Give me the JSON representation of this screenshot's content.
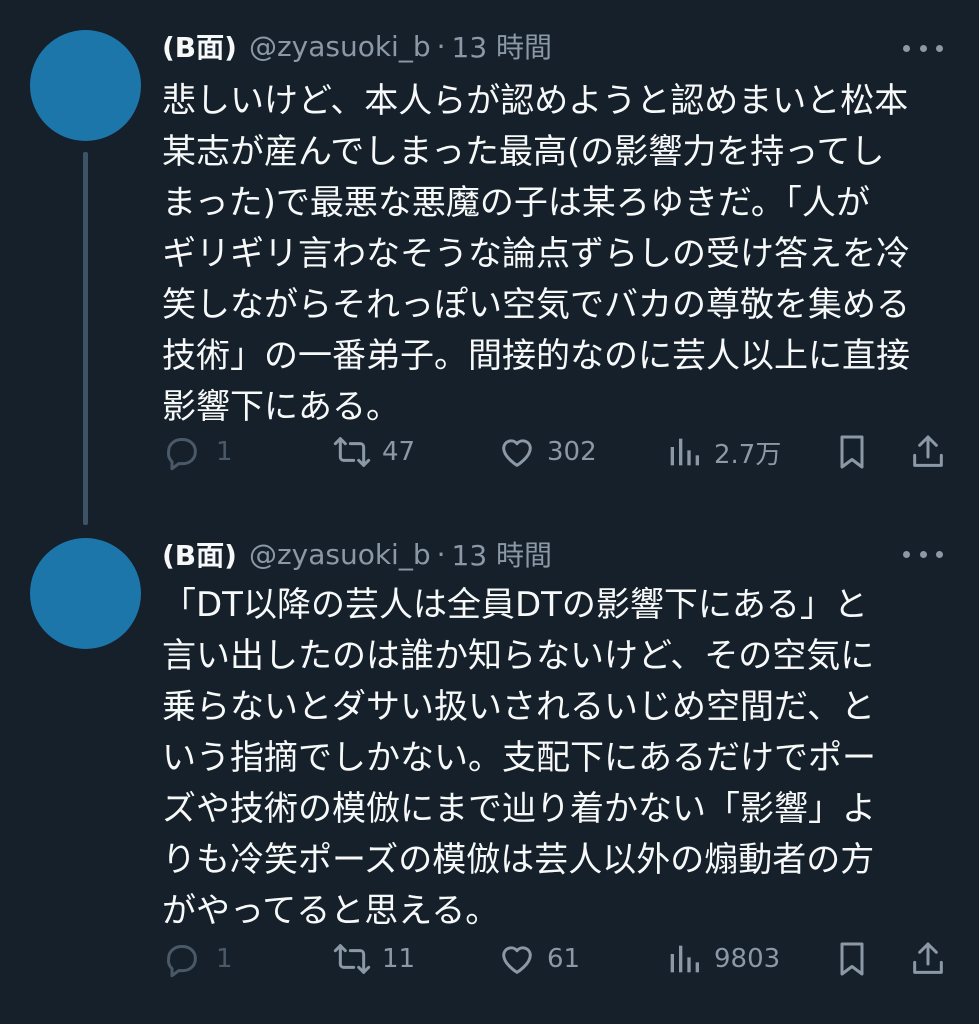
{
  "tweets": [
    {
      "display_name": "(B面)",
      "handle": "@zyasuoki_b",
      "separator": "·",
      "time": "13 時間",
      "avatar_color": "#1d76aa",
      "lines": [
        "悲しいけど、本人らが認めようと認めまいと松本",
        "某志が産んでしまった最高(の影響力を持ってし",
        "まった)で最悪な悪魔の子は某ろゆきだ。「人が",
        "ギリギリ言わなそうな論点ずらしの受け答えを冷",
        "笑しながらそれっぽい空気でバカの尊敬を集める",
        "技術」の一番弟子。間接的なのに芸人以上に直接",
        "影響下にある。"
      ],
      "actions": {
        "reply_icon": "reply-icon",
        "reply_count": "1",
        "retweet_icon": "retweet-icon",
        "retweet_count": "47",
        "like_icon": "heart-icon",
        "like_count": "302",
        "views_icon": "bar-chart-icon",
        "views_count": "2.7万",
        "bookmark_icon": "bookmark-icon",
        "share_icon": "share-icon"
      }
    },
    {
      "display_name": "(B面)",
      "handle": "@zyasuoki_b",
      "separator": "·",
      "time": "13 時間",
      "avatar_color": "#1d76aa",
      "lines": [
        "「DT以降の芸人は全員DTの影響下にある」と",
        "言い出したのは誰か知らないけど、その空気に",
        "乗らないとダサい扱いされるいじめ空間だ、と",
        "いう指摘でしかない。支配下にあるだけでポー",
        "ズや技術の模倣にまで辿り着かない「影響」よ",
        "りも冷笑ポーズの模倣は芸人以外の煽動者の方",
        "がやってると思える。"
      ],
      "actions": {
        "reply_icon": "reply-icon",
        "reply_count": "1",
        "retweet_icon": "retweet-icon",
        "retweet_count": "11",
        "like_icon": "heart-icon",
        "like_count": "61",
        "views_icon": "bar-chart-icon",
        "views_count": "9803",
        "bookmark_icon": "bookmark-icon",
        "share_icon": "share-icon"
      }
    }
  ],
  "colors": {
    "background": "#15202b",
    "text_primary": "#f7f9f9",
    "text_secondary": "#8b98a5",
    "thread_line": "#3d5466"
  }
}
